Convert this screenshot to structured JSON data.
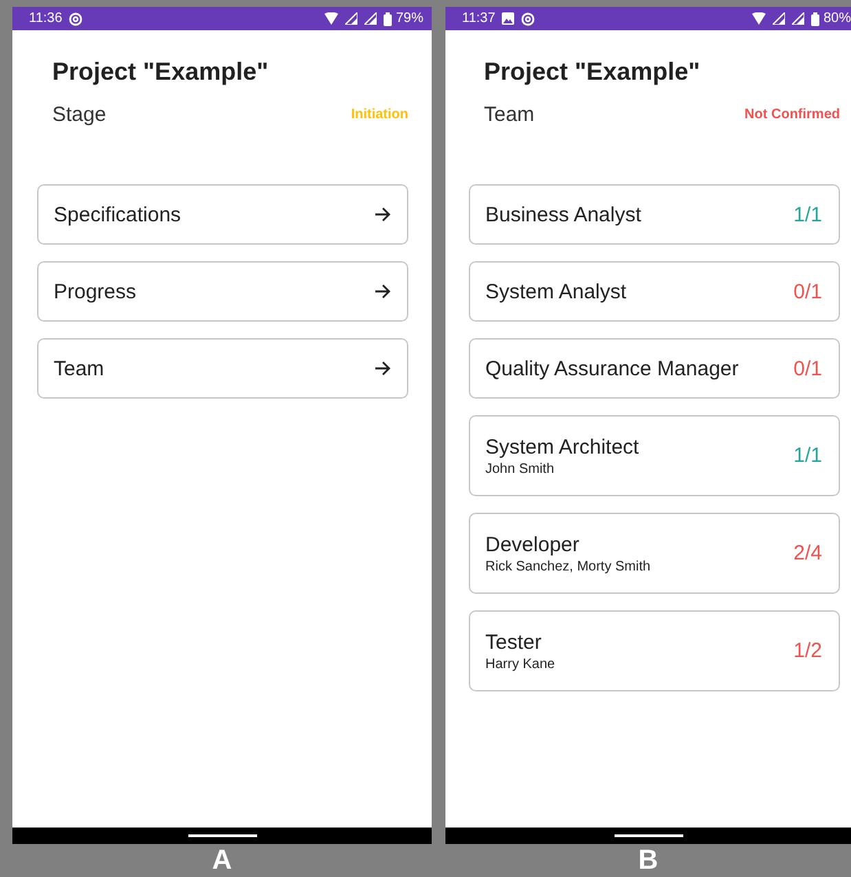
{
  "screens": [
    {
      "label": "A",
      "status_bar": {
        "time": "11:36",
        "gallery_icon": false,
        "battery": "79%"
      },
      "title": "Project \"Example\"",
      "subtitle": "Stage",
      "state": {
        "text": "Initiation",
        "color": "#ffc107"
      },
      "items": [
        {
          "kind": "link",
          "label": "Specifications"
        },
        {
          "kind": "link",
          "label": "Progress"
        },
        {
          "kind": "link",
          "label": "Team"
        }
      ]
    },
    {
      "label": "B",
      "status_bar": {
        "time": "11:37",
        "gallery_icon": true,
        "battery": "80%"
      },
      "title": "Project \"Example\"",
      "subtitle": "Team",
      "state": {
        "text": "Not Confirmed",
        "color": "#ef5350"
      },
      "items": [
        {
          "kind": "role",
          "label": "Business Analyst",
          "count": "1/1",
          "color": "#26a69a"
        },
        {
          "kind": "role",
          "label": "System Analyst",
          "count": "0/1",
          "color": "#ef5350"
        },
        {
          "kind": "role",
          "label": "Quality Assurance Manager",
          "count": "0/1",
          "color": "#ef5350"
        },
        {
          "kind": "role",
          "label": "System Architect",
          "members": "John Smith",
          "count": "1/1",
          "color": "#26a69a"
        },
        {
          "kind": "role",
          "label": "Developer",
          "members": "Rick Sanchez, Morty Smith",
          "count": "2/4",
          "color": "#ef5350"
        },
        {
          "kind": "role",
          "label": "Tester",
          "members": "Harry Kane",
          "count": "1/2",
          "color": "#ef5350"
        }
      ]
    }
  ]
}
